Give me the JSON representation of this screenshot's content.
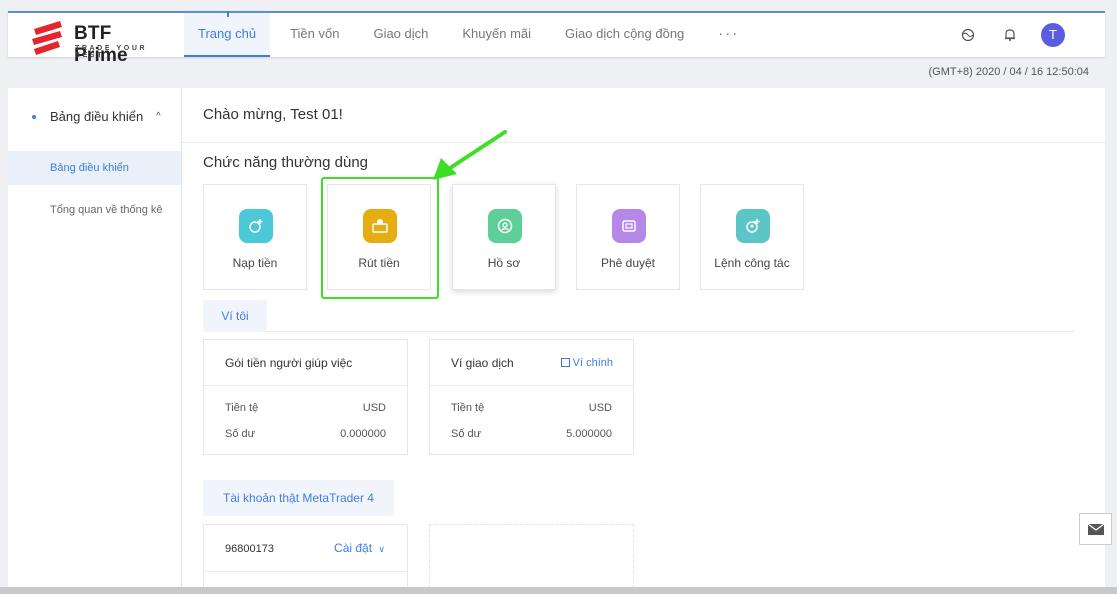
{
  "brand": {
    "name": "BTF Prime",
    "tagline": "TRADE YOUR BEST",
    "accent": "#3d7ee0",
    "logo_red": "#e3262d"
  },
  "nav": {
    "items": [
      "Trang chủ",
      "Tiền vốn",
      "Giao dịch",
      "Khuyến mãi",
      "Giao dịch cộng đồng"
    ],
    "more": "···",
    "active_index": 0
  },
  "header_icons": [
    "globe-icon",
    "bell-icon"
  ],
  "user": {
    "initial": "T",
    "color": "#5c5ce0"
  },
  "datetime": "(GMT+8) 2020 / 04 / 16 12:50:04",
  "sidebar": {
    "group_label": "Bảng điều khiển",
    "items": [
      {
        "label": "Bảng điều khiển",
        "active": true
      },
      {
        "label": "Tổng quan về thống kê",
        "active": false
      }
    ]
  },
  "main": {
    "welcome": "Chào mừng, Test 01!",
    "section_title": "Chức năng thường dùng",
    "functions": [
      {
        "label": "Nạp tiền",
        "icon": "deposit-icon",
        "color": "#4cc9d6"
      },
      {
        "label": "Rút tiền",
        "icon": "withdraw-icon",
        "color": "#e5ad0f"
      },
      {
        "label": "Hồ sơ",
        "icon": "profile-icon",
        "color": "#5fcf99"
      },
      {
        "label": "Phê duyệt",
        "icon": "approval-icon",
        "color": "#b487e8"
      },
      {
        "label": "Lệnh công tác",
        "icon": "task-icon",
        "color": "#5cc6c6"
      }
    ],
    "highlight_color": "#3dde24",
    "wallet_tab": "Ví tôi",
    "wallets": [
      {
        "title": "Gói tiền người giúp việc",
        "link": "",
        "currency_label": "Tiền tệ",
        "currency": "USD",
        "balance_label": "Số dư",
        "balance": "0.000000"
      },
      {
        "title": "Ví giao dịch",
        "link": "Ví chính",
        "currency_label": "Tiền tệ",
        "currency": "USD",
        "balance_label": "Số dư",
        "balance": "5.000000"
      }
    ],
    "mt_tab": "Tài khoản thật MetaTrader 4",
    "account": {
      "number": "96800173",
      "settings": "Cài đặt"
    }
  }
}
